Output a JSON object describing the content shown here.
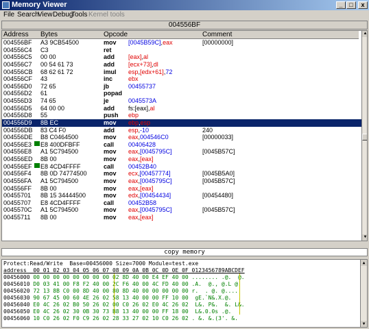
{
  "window": {
    "title": "Memory Viewer",
    "min": "_",
    "max": "□",
    "close": "x"
  },
  "menu": [
    "File",
    "Search",
    "View",
    "Debug",
    "Tools",
    "Kernel tools"
  ],
  "address_bar": "004556BF",
  "columns": {
    "address": "Address",
    "bytes": "Bytes",
    "opcode": "Opcode",
    "comment": "Comment"
  },
  "rows": [
    {
      "addr": "004556BF",
      "bytes": "A3 9CB54500",
      "op": "mov",
      "args": [
        [
          "[0045B59C]",
          "blue"
        ],
        [
          ",",
          ""
        ],
        [
          "eax",
          "red"
        ]
      ],
      "cmt": "[00000000]"
    },
    {
      "addr": "004556C4",
      "bytes": "C3",
      "op": "ret",
      "args": [],
      "cmt": ""
    },
    {
      "addr": "004556C5",
      "bytes": "00 00",
      "op": "add",
      "args": [
        [
          "[eax]",
          "red"
        ],
        [
          ",",
          ""
        ],
        [
          "al",
          "red"
        ]
      ],
      "cmt": ""
    },
    {
      "addr": "004556C7",
      "bytes": "00 54 61 73",
      "op": "add",
      "args": [
        [
          "[ecx+73]",
          "red"
        ],
        [
          ",",
          ""
        ],
        [
          "dl",
          "red"
        ]
      ],
      "cmt": ""
    },
    {
      "addr": "004556CB",
      "bytes": "68 62 61 72",
      "op": "imul",
      "args": [
        [
          "esp",
          "red"
        ],
        [
          ",",
          ""
        ],
        [
          "[edx+61]",
          "red"
        ],
        [
          ",",
          ""
        ],
        [
          "72",
          "blue"
        ]
      ],
      "cmt": ""
    },
    {
      "addr": "004556CF",
      "bytes": "43",
      "op": "inc",
      "args": [
        [
          "ebx",
          "red"
        ]
      ],
      "cmt": ""
    },
    {
      "addr": "004556D0",
      "bytes": "72 65",
      "op": "jb",
      "args": [
        [
          "00455737",
          "blue"
        ]
      ],
      "cmt": ""
    },
    {
      "addr": "004556D2",
      "bytes": "61",
      "op": "popad",
      "args": [],
      "cmt": ""
    },
    {
      "addr": "004556D3",
      "bytes": "74 65",
      "op": "je",
      "args": [
        [
          "0045573A",
          "blue"
        ]
      ],
      "cmt": ""
    },
    {
      "addr": "004556D5",
      "bytes": "64 00 00",
      "op": "add",
      "args": [
        [
          "fs:[eax]",
          "black"
        ],
        [
          ",",
          ""
        ],
        [
          "al",
          "red"
        ]
      ],
      "cmt": ""
    },
    {
      "addr": "004556D8",
      "bytes": "55",
      "op": "push",
      "args": [
        [
          "ebp",
          "red"
        ]
      ],
      "cmt": ""
    },
    {
      "addr": "004556D9",
      "bytes": "8B EC",
      "op": "mov",
      "args": [
        [
          "ebp",
          "red"
        ],
        [
          ",",
          ""
        ],
        [
          "esp",
          "red"
        ]
      ],
      "cmt": "",
      "sel": true
    },
    {
      "addr": "004556DB",
      "bytes": "83 C4 F0",
      "op": "add",
      "args": [
        [
          "esp",
          "red"
        ],
        [
          ",",
          ""
        ],
        [
          "-10",
          "blue"
        ]
      ],
      "cmt": "240"
    },
    {
      "addr": "004556DE",
      "bytes": "B8 C0464500",
      "op": "mov",
      "args": [
        [
          "eax",
          "red"
        ],
        [
          ",",
          ""
        ],
        [
          "004546C0",
          "blue"
        ]
      ],
      "cmt": "[00000033]"
    },
    {
      "addr": "004556E3",
      "bytes": "E8 400DFBFF",
      "op": "call",
      "args": [
        [
          "00406428",
          "blue"
        ]
      ],
      "cmt": "",
      "bp": true
    },
    {
      "addr": "004556E8",
      "bytes": "A1 5C794500",
      "op": "mov",
      "args": [
        [
          "eax",
          "red"
        ],
        [
          ",",
          ""
        ],
        [
          "[0045795C]",
          "blue"
        ]
      ],
      "cmt": "[0045B57C]"
    },
    {
      "addr": "004556ED",
      "bytes": "8B 00",
      "op": "mov",
      "args": [
        [
          "eax",
          "red"
        ],
        [
          ",",
          ""
        ],
        [
          "[eax]",
          "red"
        ]
      ],
      "cmt": ""
    },
    {
      "addr": "004556EF",
      "bytes": "E8 4CD4FFFF",
      "op": "call",
      "args": [
        [
          "00452B40",
          "blue"
        ]
      ],
      "cmt": "",
      "bp": true
    },
    {
      "addr": "004556F4",
      "bytes": "8B 0D 74774500",
      "op": "mov",
      "args": [
        [
          "ecx",
          "red"
        ],
        [
          ",",
          ""
        ],
        [
          "[00457774]",
          "blue"
        ]
      ],
      "cmt": "[0045B5A0]"
    },
    {
      "addr": "004556FA",
      "bytes": "A1 5C794500",
      "op": "mov",
      "args": [
        [
          "eax",
          "red"
        ],
        [
          ",",
          ""
        ],
        [
          "[0045795C]",
          "blue"
        ]
      ],
      "cmt": "[0045B57C]"
    },
    {
      "addr": "004556FF",
      "bytes": "8B 00",
      "op": "mov",
      "args": [
        [
          "eax",
          "red"
        ],
        [
          ",",
          ""
        ],
        [
          "[eax]",
          "red"
        ]
      ],
      "cmt": ""
    },
    {
      "addr": "00455701",
      "bytes": "8B 15 34444500",
      "op": "mov",
      "args": [
        [
          "edx",
          "red"
        ],
        [
          ",",
          ""
        ],
        [
          "[00454434]",
          "blue"
        ]
      ],
      "cmt": "[00454480]"
    },
    {
      "addr": "00455707",
      "bytes": "E8 4CD4FFFF",
      "op": "call",
      "args": [
        [
          "00452B58",
          "blue"
        ]
      ],
      "cmt": ""
    },
    {
      "addr": "0045570C",
      "bytes": "A1 5C794500",
      "op": "mov",
      "args": [
        [
          "eax",
          "red"
        ],
        [
          ",",
          ""
        ],
        [
          "[0045795C]",
          "blue"
        ]
      ],
      "cmt": "[0045B57C]"
    },
    {
      "addr": "00455711",
      "bytes": "8B 00",
      "op": "mov",
      "args": [
        [
          "eax",
          "red"
        ],
        [
          ",",
          ""
        ],
        [
          "[eax]",
          "red"
        ]
      ],
      "cmt": ""
    }
  ],
  "copy_memory": "copy memory",
  "hex": {
    "info": "Protect:Read/Write  Base=00456000 Size=7000 Module=test.exe",
    "header": "address  00 01 02 03 04 05 06 07 08 09 0A 0B 0C 0D 0E 0F 0123456789ABCDEF",
    "rows": [
      {
        "addr": "00456000",
        "hex": "00 00 00 00 00 00 00 00 02 8D 40 00 E4 EF 40 00",
        "asc": "........ .@.  @."
      },
      {
        "addr": "00456010",
        "hex": "D0 03 41 00 F8 F2 40 00 2C F6 40 00 4C FD 40 00",
        "asc": ".A.  @., @.L @."
      },
      {
        "addr": "00456020",
        "hex": "72 13 8B C0 00 8D 40 00 80 8D 40 00 00 00 00 00",
        "asc": "r.  . @. @...."
      },
      {
        "addr": "00456030",
        "hex": "90 67 45 00 60 4E 26 02 58 13 40 00 00 FF 10 00",
        "asc": " gE.`N&.X.@.  ."
      },
      {
        "addr": "00456040",
        "hex": "E0 4C 26 02 B0 50 26 02 00 C0 26 02 E0 4C 26 02",
        "asc": " L&. P&.  &. L&."
      },
      {
        "addr": "00456050",
        "hex": "E0 4C 26 02 30 0B 30 73 B8 13 40 00 00 FF 18 00",
        "asc": " L&.0.0s .@.  ."
      },
      {
        "addr": "00456060",
        "hex": "10 C0 26 02 F0 C9 26 02 28 33 27 02 10 C0 26 02",
        "asc": ". &. &.(3'. &."
      }
    ]
  },
  "colors": {
    "title_from": "#0a246a",
    "title_to": "#a6caf0",
    "selection": "#0a246a",
    "red": "#e00000",
    "blue": "#0000e0",
    "hexgreen": "#008000",
    "breakpoint": "#008000"
  }
}
